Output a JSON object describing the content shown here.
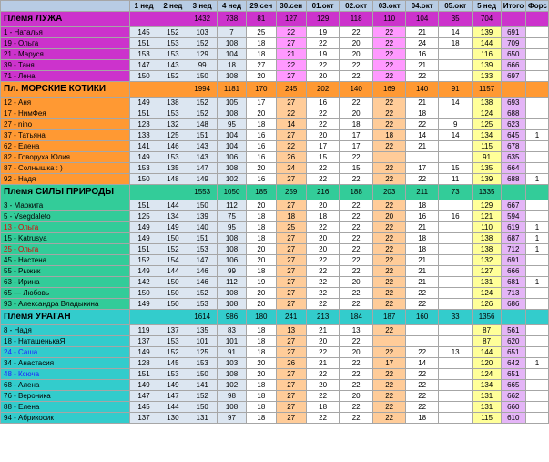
{
  "header": {
    "cols": [
      "1 нед",
      "2 нед",
      "3 нед",
      "4 нед",
      "29.сен",
      "30.сен",
      "01.окт",
      "02.окт",
      "03.окт",
      "04.окт",
      "05.окт",
      "5 нед",
      "Итого",
      "Форс"
    ]
  },
  "colors": {
    "header_bg": "#b8cce4",
    "luzha": "#cc33cc",
    "kotiki": "#ff9933",
    "sily": "#33cc99",
    "uragan": "#33cccc",
    "week_lightblue": "#dce6f1",
    "week_yellow": "#ffff99",
    "total_purple": "#e4b5f7",
    "day_pink": "#ff99ff",
    "day_peach": "#ffcc99",
    "day_green": "#ccff99",
    "day_cream": "#ffffcc"
  },
  "groups": [
    {
      "id": "luzha",
      "name": "Племя ЛУЖА",
      "summary": [
        "",
        "",
        "1432",
        "738",
        "81",
        "127",
        "129",
        "118",
        "110",
        "104",
        "35",
        "704",
        "",
        ""
      ],
      "rows": [
        {
          "name": "1 - Наталья",
          "vals": [
            "145",
            "152",
            "103",
            "7",
            "25",
            "22",
            "19",
            "22",
            "22",
            "21",
            "14",
            "139",
            "691",
            ""
          ],
          "hl": []
        },
        {
          "name": "19 - Ольга",
          "vals": [
            "151",
            "153",
            "152",
            "108",
            "18",
            "27",
            "22",
            "20",
            "22",
            "24",
            "18",
            "144",
            "709",
            ""
          ],
          "hl": []
        },
        {
          "name": "21 - Маруся",
          "vals": [
            "153",
            "153",
            "129",
            "104",
            "18",
            "21",
            "19",
            "20",
            "22",
            "16",
            "",
            "116",
            "650",
            ""
          ],
          "hl": []
        },
        {
          "name": "39 - Таня",
          "vals": [
            "147",
            "143",
            "99",
            "18",
            "27",
            "22",
            "22",
            "22",
            "22",
            "21",
            "",
            "139",
            "666",
            ""
          ],
          "hl": []
        },
        {
          "name": "71 - Лена",
          "vals": [
            "150",
            "152",
            "150",
            "108",
            "20",
            "27",
            "20",
            "22",
            "22",
            "22",
            "",
            "133",
            "697",
            ""
          ],
          "hl": []
        }
      ]
    },
    {
      "id": "kotiki",
      "name": "Пл. МОРСКИЕ КОТИКИ",
      "summary": [
        "",
        "",
        "1994",
        "1181",
        "170",
        "245",
        "202",
        "140",
        "169",
        "140",
        "91",
        "1157",
        "",
        ""
      ],
      "rows": [
        {
          "name": "12 - Аня",
          "vals": [
            "149",
            "138",
            "152",
            "105",
            "17",
            "27",
            "16",
            "22",
            "22",
            "21",
            "14",
            "138",
            "693",
            ""
          ],
          "hl": []
        },
        {
          "name": "17 - НимФея",
          "vals": [
            "151",
            "153",
            "152",
            "108",
            "20",
            "22",
            "22",
            "20",
            "22",
            "18",
            "",
            "124",
            "688",
            ""
          ],
          "hl": []
        },
        {
          "name": "27 - nino",
          "vals": [
            "123",
            "132",
            "148",
            "95",
            "18",
            "14",
            "22",
            "18",
            "22",
            "22",
            "9",
            "125",
            "623",
            ""
          ],
          "hl": []
        },
        {
          "name": "37 - Татьяна",
          "vals": [
            "133",
            "125",
            "151",
            "104",
            "16",
            "27",
            "20",
            "17",
            "18",
            "14",
            "14",
            "134",
            "645",
            "1"
          ],
          "hl": []
        },
        {
          "name": "62 - Елена",
          "vals": [
            "141",
            "146",
            "143",
            "104",
            "16",
            "22",
            "17",
            "17",
            "22",
            "21",
            "",
            "115",
            "678",
            ""
          ],
          "hl": []
        },
        {
          "name": "82 - Говоруха Юлия",
          "vals": [
            "149",
            "153",
            "143",
            "106",
            "16",
            "26",
            "15",
            "22",
            "",
            "",
            "",
            "91",
            "635",
            ""
          ],
          "hl": []
        },
        {
          "name": "87 - Солнышка : )",
          "vals": [
            "153",
            "135",
            "147",
            "108",
            "20",
            "24",
            "22",
            "15",
            "22",
            "17",
            "15",
            "135",
            "664",
            ""
          ],
          "hl": []
        },
        {
          "name": "92 - Надя",
          "vals": [
            "150",
            "148",
            "149",
            "102",
            "16",
            "27",
            "22",
            "22",
            "22",
            "22",
            "11",
            "139",
            "688",
            "1"
          ],
          "hl": []
        }
      ]
    },
    {
      "id": "sily",
      "name": "Племя СИЛЫ ПРИРОДЫ",
      "summary": [
        "",
        "",
        "1553",
        "1050",
        "185",
        "259",
        "216",
        "188",
        "203",
        "211",
        "73",
        "1335",
        "",
        ""
      ],
      "rows": [
        {
          "name": "3 - Маркита",
          "vals": [
            "151",
            "144",
            "150",
            "112",
            "20",
            "27",
            "20",
            "22",
            "22",
            "18",
            "",
            "129",
            "667",
            ""
          ],
          "hl": []
        },
        {
          "name": "5 - Vsegdaleto",
          "vals": [
            "125",
            "134",
            "139",
            "75",
            "18",
            "18",
            "18",
            "22",
            "20",
            "16",
            "16",
            "121",
            "594",
            ""
          ],
          "hl": []
        },
        {
          "name": "13 - Ольга",
          "vals": [
            "149",
            "149",
            "140",
            "95",
            "18",
            "25",
            "22",
            "22",
            "22",
            "21",
            "",
            "110",
            "619",
            "1"
          ],
          "red": true
        },
        {
          "name": "15 - Katrusya",
          "vals": [
            "149",
            "150",
            "151",
            "108",
            "18",
            "27",
            "20",
            "22",
            "22",
            "18",
            "",
            "138",
            "687",
            "1"
          ],
          "hl": []
        },
        {
          "name": "25 - Ольга",
          "vals": [
            "151",
            "152",
            "153",
            "108",
            "20",
            "27",
            "20",
            "22",
            "22",
            "18",
            "",
            "138",
            "712",
            "1"
          ],
          "red": true
        },
        {
          "name": "45 - Настена",
          "vals": [
            "152",
            "154",
            "147",
            "106",
            "20",
            "27",
            "22",
            "22",
            "22",
            "21",
            "",
            "132",
            "691",
            ""
          ],
          "hl": []
        },
        {
          "name": "55 - Рыжик",
          "vals": [
            "149",
            "144",
            "146",
            "99",
            "18",
            "27",
            "22",
            "22",
            "22",
            "21",
            "",
            "127",
            "666",
            ""
          ],
          "hl": []
        },
        {
          "name": "63 - Ирина",
          "vals": [
            "142",
            "150",
            "146",
            "112",
            "19",
            "27",
            "22",
            "20",
            "22",
            "21",
            "",
            "131",
            "681",
            "1"
          ],
          "hl": []
        },
        {
          "name": "65 — Любовь",
          "vals": [
            "150",
            "150",
            "152",
            "108",
            "20",
            "27",
            "22",
            "22",
            "22",
            "22",
            "",
            "124",
            "713",
            ""
          ],
          "hl": []
        },
        {
          "name": "93 - Александра Владыкина",
          "vals": [
            "149",
            "150",
            "153",
            "108",
            "20",
            "27",
            "22",
            "22",
            "22",
            "22",
            "",
            "126",
            "686",
            ""
          ],
          "hl": []
        }
      ]
    },
    {
      "id": "uragan",
      "name": "Племя УРАГАН",
      "summary": [
        "",
        "",
        "1614",
        "986",
        "180",
        "241",
        "213",
        "184",
        "187",
        "160",
        "33",
        "1356",
        "",
        ""
      ],
      "rows": [
        {
          "name": "8 - Надя",
          "vals": [
            "119",
            "137",
            "135",
            "83",
            "18",
            "13",
            "21",
            "13",
            "22",
            "",
            "",
            "87",
            "561",
            ""
          ],
          "hl": []
        },
        {
          "name": "18 - НаташенькаЯ",
          "vals": [
            "137",
            "153",
            "101",
            "101",
            "18",
            "27",
            "20",
            "22",
            "",
            "",
            "",
            "87",
            "620",
            ""
          ],
          "hl": []
        },
        {
          "name": "24 - Саша",
          "vals": [
            "149",
            "152",
            "125",
            "91",
            "18",
            "27",
            "22",
            "20",
            "22",
            "22",
            "13",
            "144",
            "651",
            ""
          ],
          "blue": true
        },
        {
          "name": "34 - Анастасия",
          "vals": [
            "128",
            "145",
            "153",
            "103",
            "20",
            "26",
            "21",
            "22",
            "17",
            "14",
            "",
            "120",
            "642",
            "1"
          ],
          "hl": []
        },
        {
          "name": "48 - Ксюча",
          "vals": [
            "151",
            "153",
            "150",
            "108",
            "20",
            "27",
            "22",
            "22",
            "22",
            "22",
            "",
            "124",
            "651",
            ""
          ],
          "blue": true
        },
        {
          "name": "68 - Алена",
          "vals": [
            "149",
            "149",
            "141",
            "102",
            "18",
            "27",
            "20",
            "22",
            "22",
            "22",
            "",
            "134",
            "665",
            ""
          ],
          "hl": []
        },
        {
          "name": "76 - Вероника",
          "vals": [
            "147",
            "147",
            "152",
            "98",
            "18",
            "27",
            "22",
            "20",
            "22",
            "22",
            "",
            "131",
            "662",
            ""
          ],
          "hl": []
        },
        {
          "name": "88 - Елена",
          "vals": [
            "145",
            "144",
            "150",
            "108",
            "18",
            "27",
            "18",
            "22",
            "22",
            "22",
            "",
            "131",
            "660",
            ""
          ],
          "hl": []
        },
        {
          "name": "94 - Абрикосик",
          "vals": [
            "137",
            "130",
            "131",
            "97",
            "18",
            "27",
            "22",
            "22",
            "22",
            "18",
            "",
            "115",
            "610",
            ""
          ],
          "hl": []
        }
      ]
    }
  ]
}
